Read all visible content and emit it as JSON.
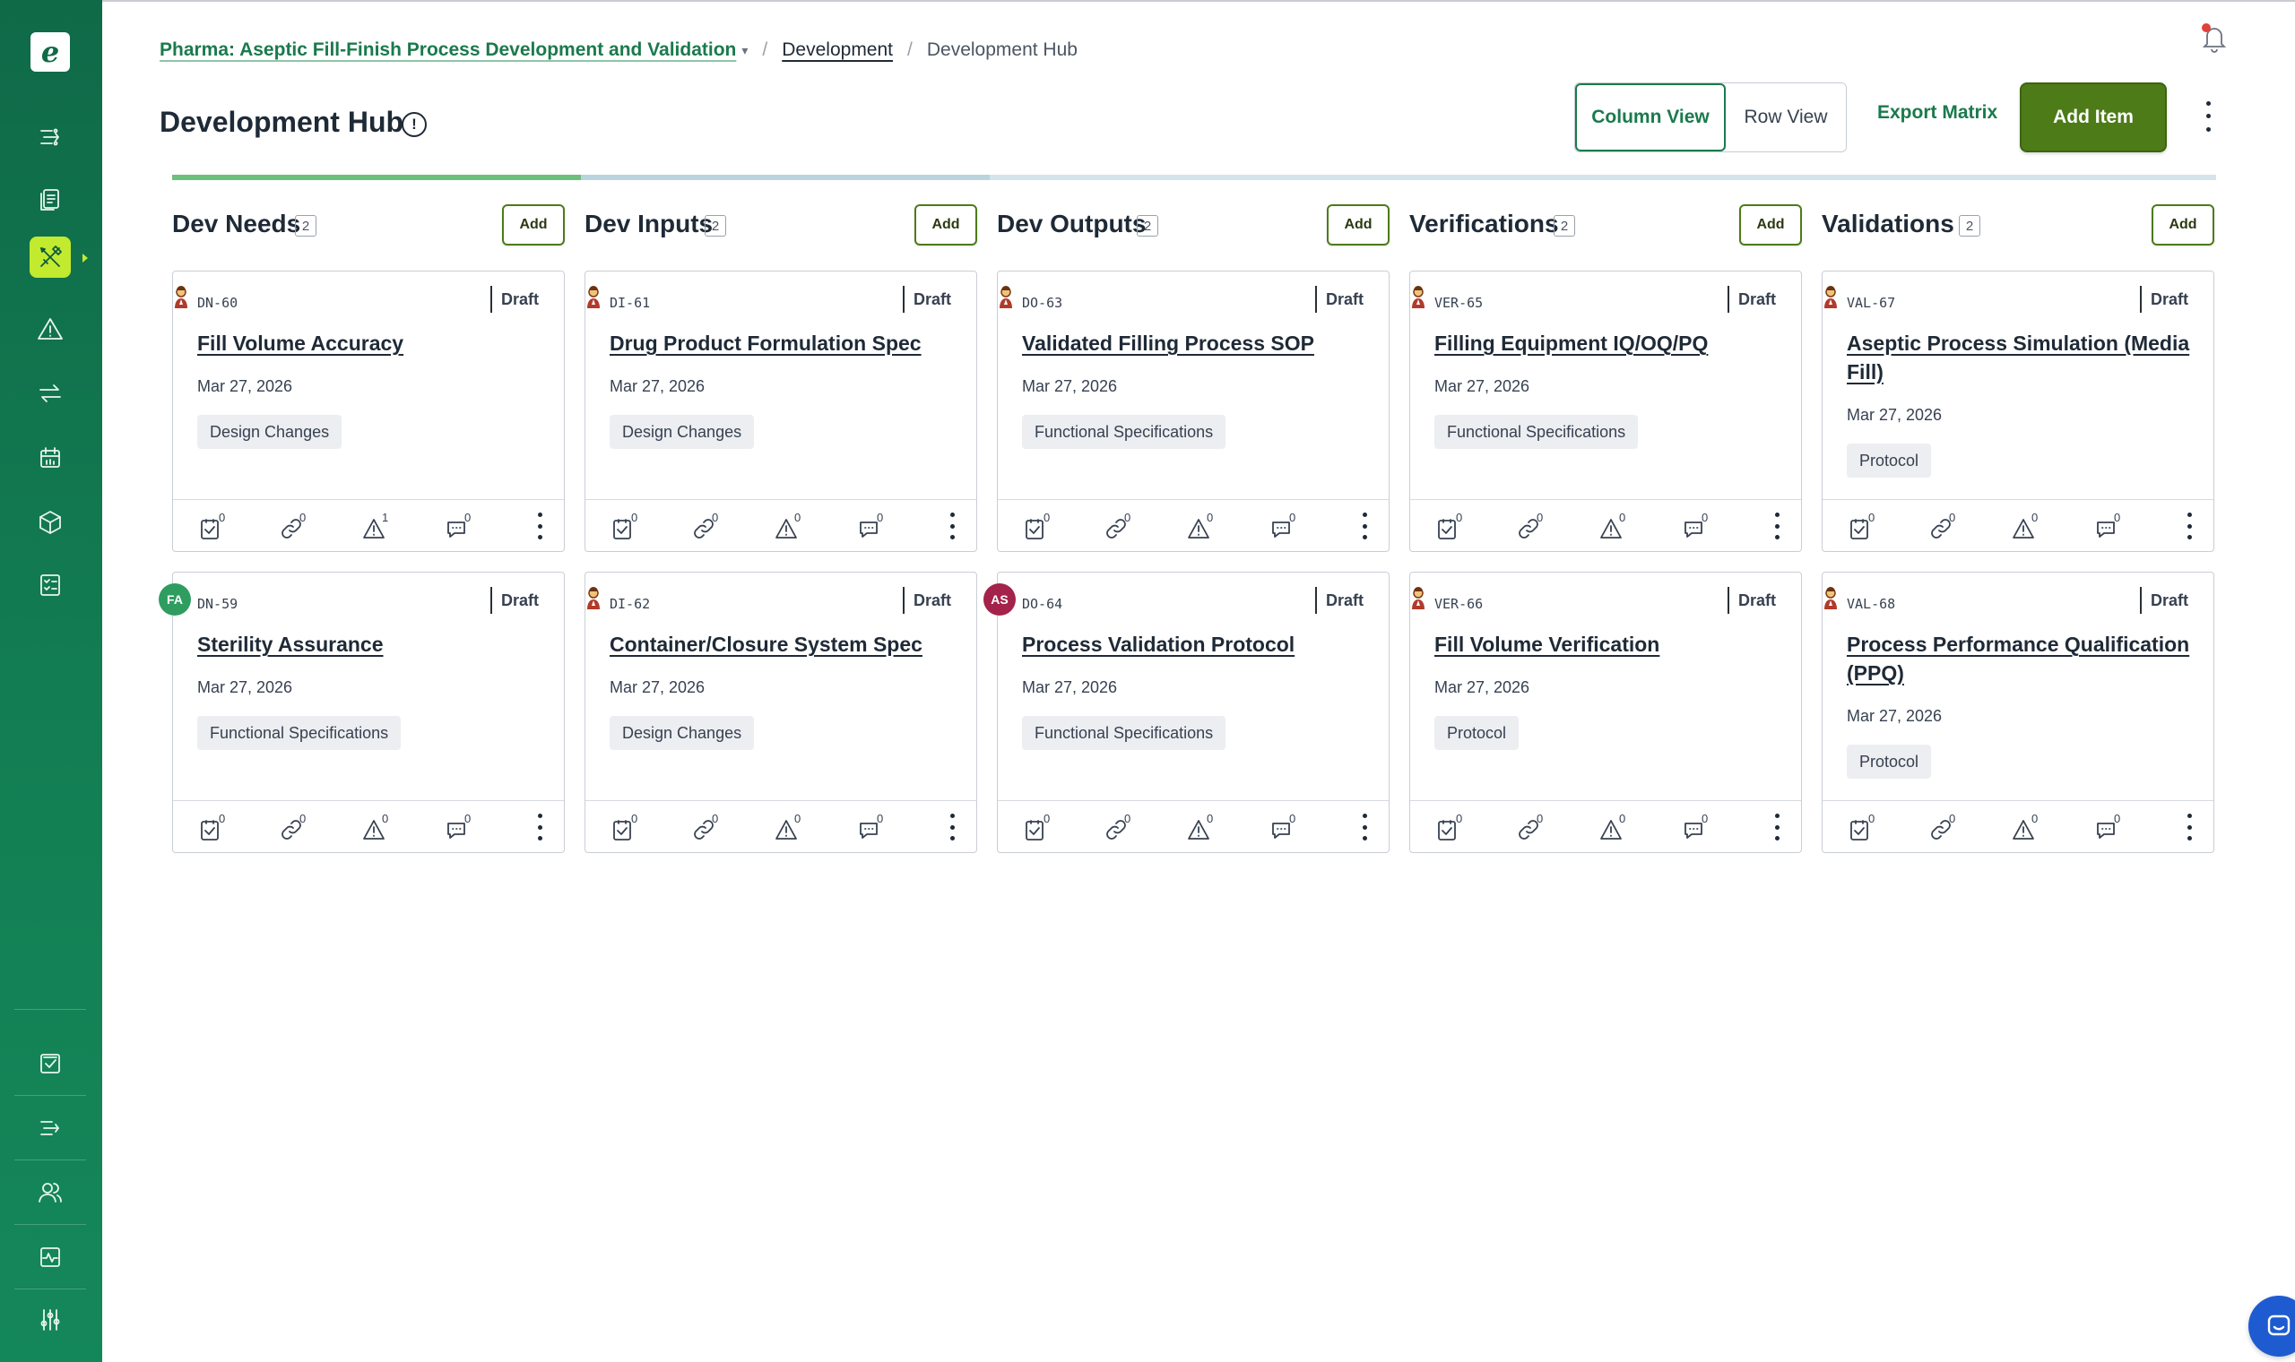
{
  "colors": {
    "sidebar": "#0f6a48",
    "accent_lime": "#c2ea2e",
    "primary_green": "#4d7b18",
    "link_green": "#1a7a4c",
    "chat_blue": "#1e5bd1",
    "progress_active": "#6cc07a",
    "progress_next": "#b9d4df",
    "progress_rest": "#d4e4ea"
  },
  "sidebar": {
    "logo_letter": "e",
    "top_icons": [
      "flow-icon",
      "documents-icon",
      "development-tools-icon",
      "risk-warning-icon",
      "transfer-icon",
      "calendar-icon",
      "package-icon",
      "checklist-icon"
    ],
    "bottom_icons": [
      "tasks-icon",
      "workflow-icon",
      "users-icon",
      "activity-icon",
      "settings-sliders-icon"
    ],
    "active_item": "development-tools-icon"
  },
  "breadcrumb": {
    "project": "Pharma: Aseptic Fill-Finish Process Development and Validation",
    "section": "Development",
    "current": "Development Hub",
    "separator": "/"
  },
  "header": {
    "title": "Development Hub",
    "info_glyph": "!",
    "column_view": "Column View",
    "row_view": "Row View",
    "export": "Export Matrix",
    "add_item": "Add Item"
  },
  "columns": [
    {
      "title": "Dev Needs",
      "count": "2",
      "add_label": "Add",
      "cards": [
        {
          "id": "DN-60",
          "status": "Draft",
          "title": "Fill Volume Accuracy",
          "date": "Mar 27, 2026",
          "tag": "Design Changes",
          "avatar": "person",
          "avatar_initials": "",
          "counts": [
            "0",
            "0",
            "1",
            "0"
          ]
        },
        {
          "id": "DN-59",
          "status": "Draft",
          "title": "Sterility Assurance",
          "date": "Mar 27, 2026",
          "tag": "Functional Specifications",
          "avatar": "initials",
          "avatar_initials": "FA",
          "avatar_color": "#2e9d5f",
          "counts": [
            "0",
            "0",
            "0",
            "0"
          ]
        }
      ]
    },
    {
      "title": "Dev Inputs",
      "count": "2",
      "add_label": "Add",
      "cards": [
        {
          "id": "DI-61",
          "status": "Draft",
          "title": "Drug Product Formulation Spec",
          "date": "Mar 27, 2026",
          "tag": "Design Changes",
          "avatar": "person",
          "avatar_initials": "",
          "counts": [
            "0",
            "0",
            "0",
            "0"
          ]
        },
        {
          "id": "DI-62",
          "status": "Draft",
          "title": "Container/Closure System Spec",
          "date": "Mar 27, 2026",
          "tag": "Design Changes",
          "avatar": "person",
          "avatar_initials": "",
          "counts": [
            "0",
            "0",
            "0",
            "0"
          ]
        }
      ]
    },
    {
      "title": "Dev Outputs",
      "count": "2",
      "add_label": "Add",
      "cards": [
        {
          "id": "DO-63",
          "status": "Draft",
          "title": "Validated Filling Process SOP",
          "date": "Mar 27, 2026",
          "tag": "Functional Specifications",
          "avatar": "person",
          "avatar_initials": "",
          "counts": [
            "0",
            "0",
            "0",
            "0"
          ]
        },
        {
          "id": "DO-64",
          "status": "Draft",
          "title": "Process Validation Protocol",
          "date": "Mar 27, 2026",
          "tag": "Functional Specifications",
          "avatar": "initials",
          "avatar_initials": "AS",
          "avatar_color": "#a3234a",
          "counts": [
            "0",
            "0",
            "0",
            "0"
          ]
        }
      ]
    },
    {
      "title": "Verifications",
      "count": "2",
      "add_label": "Add",
      "cards": [
        {
          "id": "VER-65",
          "status": "Draft",
          "title": "Filling Equipment IQ/OQ/PQ",
          "date": "Mar 27, 2026",
          "tag": "Functional Specifications",
          "avatar": "person",
          "avatar_initials": "",
          "counts": [
            "0",
            "0",
            "0",
            "0"
          ]
        },
        {
          "id": "VER-66",
          "status": "Draft",
          "title": "Fill Volume Verification",
          "date": "Mar 27, 2026",
          "tag": "Protocol",
          "avatar": "person",
          "avatar_initials": "",
          "counts": [
            "0",
            "0",
            "0",
            "0"
          ]
        }
      ]
    },
    {
      "title": "Validations",
      "count": "2",
      "add_label": "Add",
      "cards": [
        {
          "id": "VAL-67",
          "status": "Draft",
          "title": "Aseptic Process Simulation (Media Fill)",
          "date": "Mar 27, 2026",
          "tag": "Protocol",
          "avatar": "person",
          "avatar_initials": "",
          "counts": [
            "0",
            "0",
            "0",
            "0"
          ]
        },
        {
          "id": "VAL-68",
          "status": "Draft",
          "title": "Process Performance Qualification (PPQ)",
          "date": "Mar 27, 2026",
          "tag": "Protocol",
          "avatar": "person",
          "avatar_initials": "",
          "counts": [
            "0",
            "0",
            "0",
            "0"
          ]
        }
      ]
    }
  ],
  "card_footer_icons": [
    "tasks-check-icon",
    "links-icon",
    "risks-warning-icon",
    "comments-icon"
  ],
  "chat_icon": "chat-icon"
}
